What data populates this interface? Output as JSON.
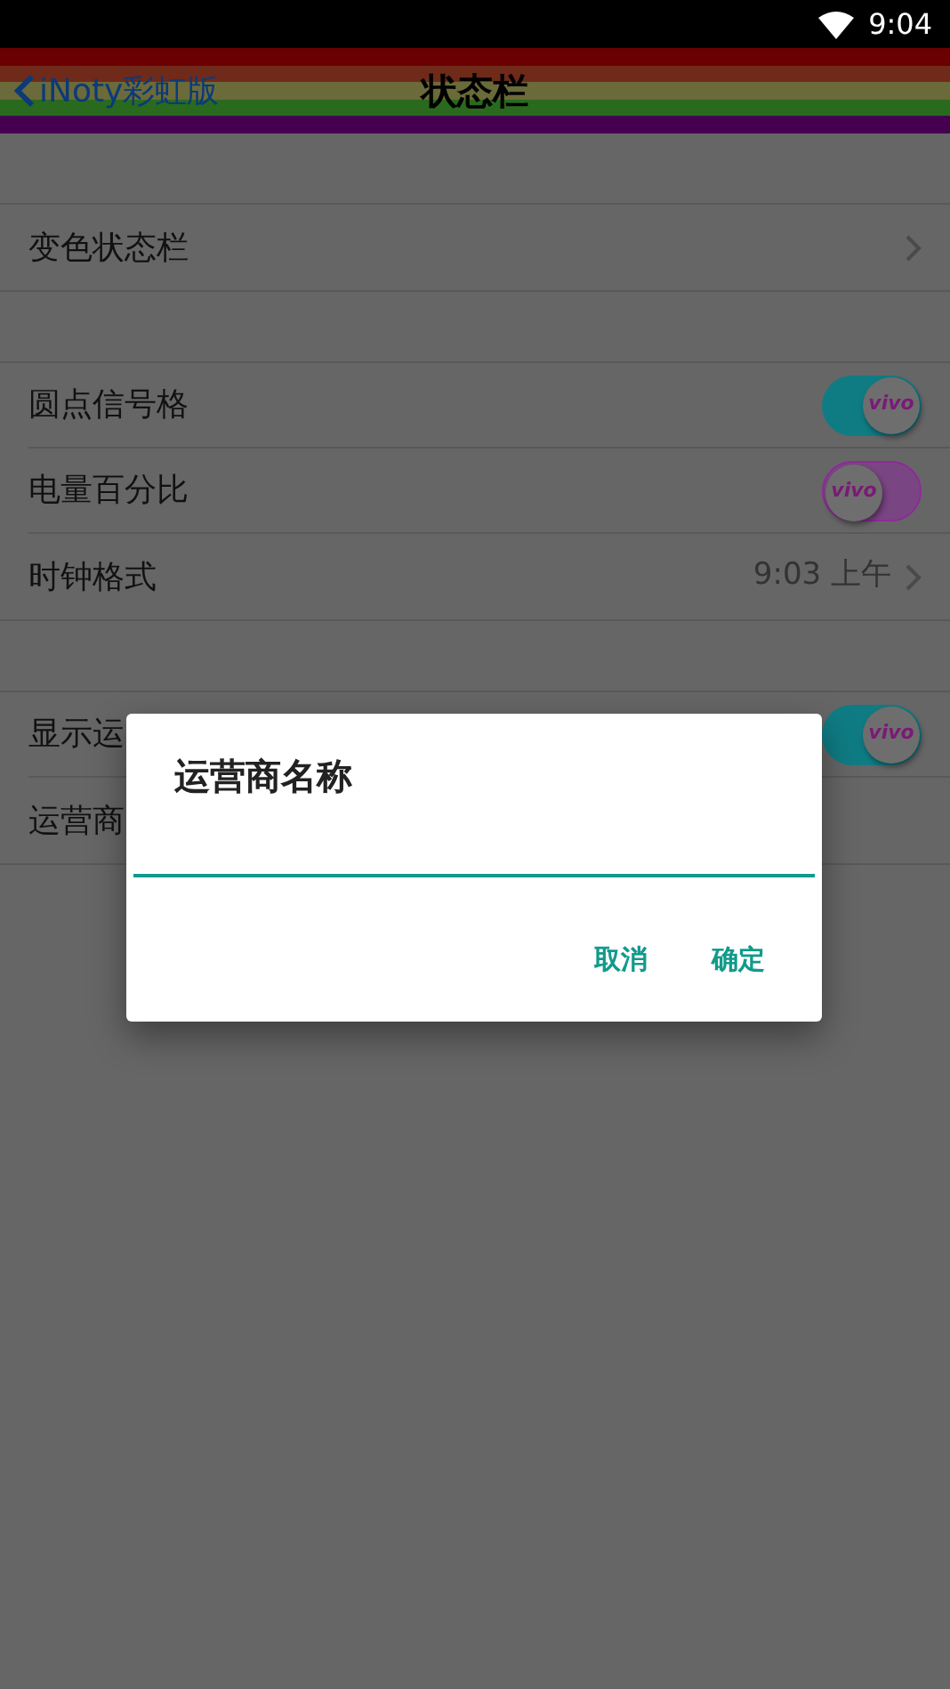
{
  "status_bar": {
    "time": "9:04"
  },
  "nav": {
    "back": "iNoty彩虹版",
    "title": "状态栏"
  },
  "groups": [
    {
      "items": [
        {
          "kind": "link",
          "label": "变色状态栏"
        }
      ]
    },
    {
      "items": [
        {
          "kind": "toggle",
          "label": "圆点信号格",
          "on": true,
          "thumb": "vivo"
        },
        {
          "kind": "toggle",
          "label": "电量百分比",
          "on": false,
          "thumb": "vivo"
        },
        {
          "kind": "link",
          "label": "时钟格式",
          "value": "9:03 上午"
        }
      ]
    },
    {
      "items": [
        {
          "kind": "toggle",
          "label": "显示运",
          "on": true,
          "thumb": "vivo"
        },
        {
          "kind": "plain",
          "label": "运营商"
        }
      ]
    }
  ],
  "dialog": {
    "title": "运营商名称",
    "input": {
      "focused": true
    },
    "buttons": [
      "取消",
      "确定"
    ]
  }
}
